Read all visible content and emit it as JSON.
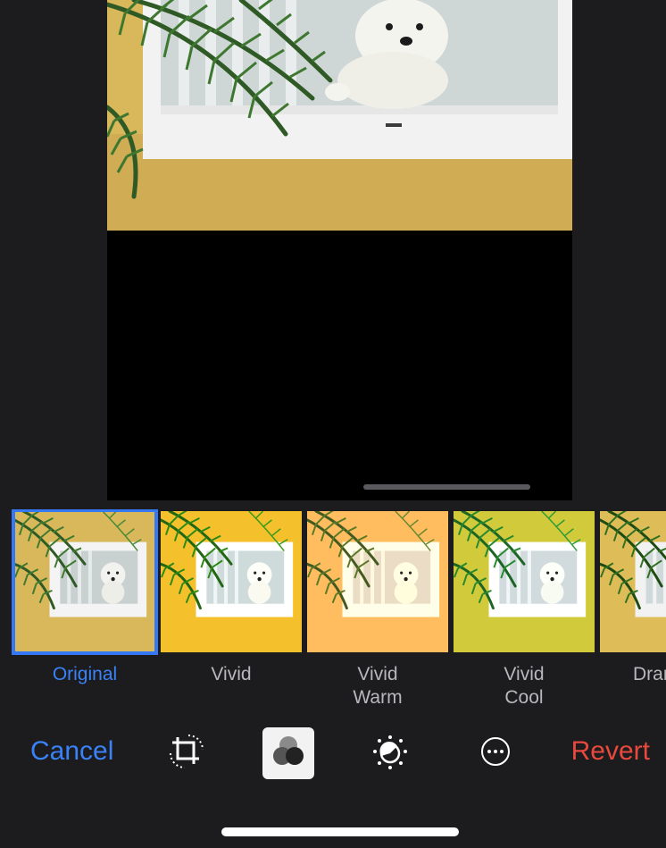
{
  "editor": {
    "photo_icon": "photo-window-dog",
    "filters": [
      {
        "label": "Original",
        "selected": true
      },
      {
        "label": "Vivid",
        "selected": false
      },
      {
        "label": "Vivid\nWarm",
        "selected": false
      },
      {
        "label": "Vivid\nCool",
        "selected": false
      },
      {
        "label": "Dramatic",
        "selected": false
      }
    ]
  },
  "toolbar": {
    "cancel_label": "Cancel",
    "revert_label": "Revert",
    "icons": [
      "crop-rotate-icon",
      "filters-icon",
      "adjust-dial-icon",
      "more-icon"
    ]
  },
  "colors": {
    "accent_blue": "#3a82f7",
    "destructive_red": "#e8493d",
    "background": "#1c1c1e"
  }
}
